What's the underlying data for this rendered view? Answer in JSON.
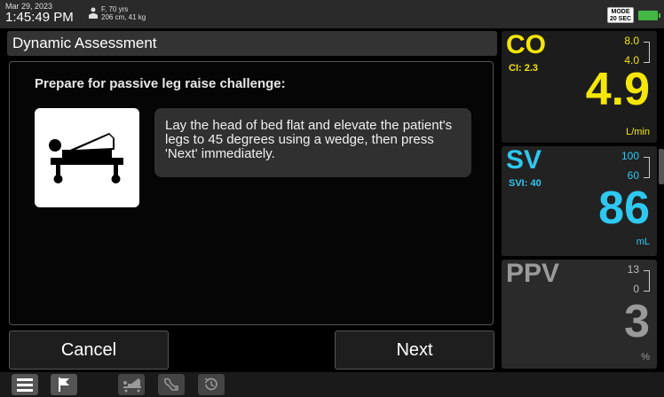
{
  "status": {
    "date": "Mar 29, 2023",
    "time": "1:45:49 PM",
    "patient_line1": "F, 70 yrs",
    "patient_line2": "206 cm, 41 kg",
    "mode_line1": "MODE",
    "mode_line2": "20 SEC"
  },
  "main": {
    "title": "Dynamic Assessment",
    "heading": "Prepare for passive leg raise challenge:",
    "instruction": "Lay the head of bed flat and elevate the patient's legs to 45 degrees using a wedge, then press 'Next' immediately.",
    "cancel_label": "Cancel",
    "next_label": "Next"
  },
  "params": {
    "co": {
      "name": "CO",
      "sub": "CI: 2.3",
      "high": "8.0",
      "low": "4.0",
      "value": "4.9",
      "unit": "L/min",
      "color": "#f5e60a"
    },
    "sv": {
      "name": "SV",
      "sub": "SVI: 40",
      "high": "100",
      "low": "60",
      "value": "86",
      "unit": "mL",
      "color": "#2ec8f0"
    },
    "ppv": {
      "name": "PPV",
      "high": "13",
      "low": "0",
      "value": "3",
      "unit": "%",
      "color": "#9a9a9a"
    }
  },
  "toolbar": {
    "icons": [
      "menu-icon",
      "flag-icon",
      "bed-icon",
      "probe-icon",
      "history-icon"
    ]
  }
}
